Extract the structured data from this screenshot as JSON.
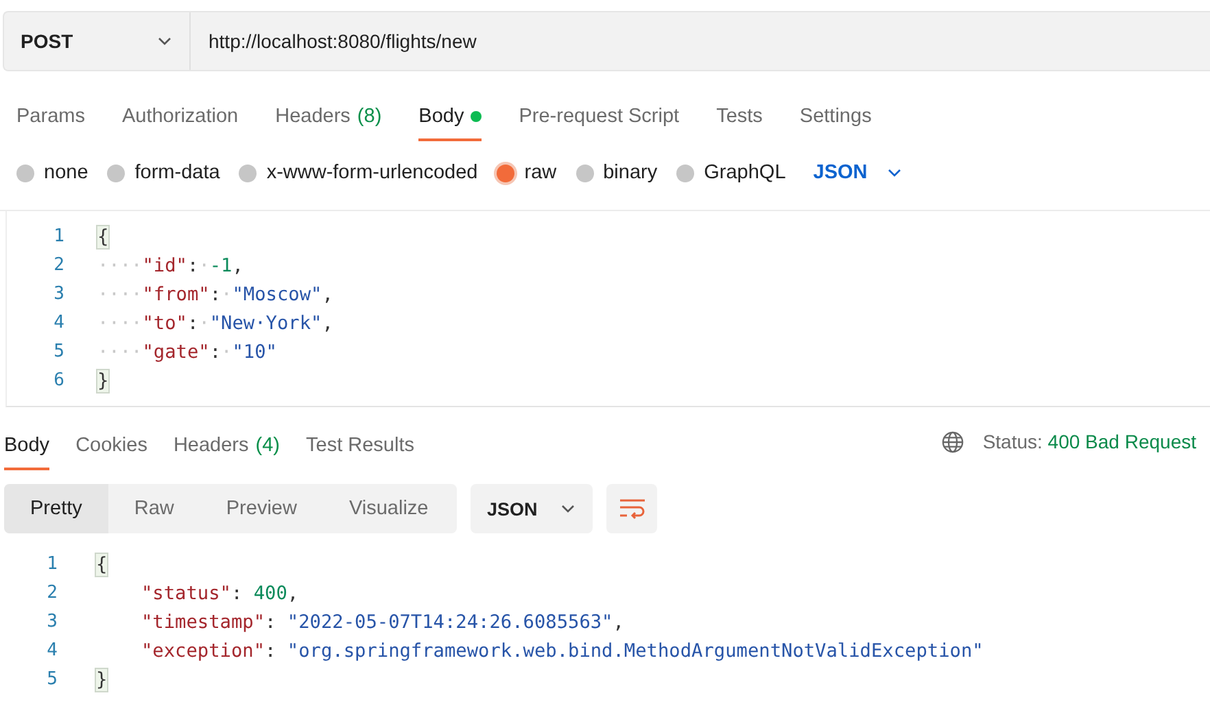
{
  "request": {
    "method": "POST",
    "url": "http://localhost:8080/flights/new"
  },
  "tabs": [
    {
      "label": "Params",
      "selected": false
    },
    {
      "label": "Authorization",
      "selected": false
    },
    {
      "label": "Headers",
      "count": "(8)",
      "selected": false
    },
    {
      "label": "Body",
      "dot": true,
      "selected": true
    },
    {
      "label": "Pre-request Script",
      "selected": false
    },
    {
      "label": "Tests",
      "selected": false
    },
    {
      "label": "Settings",
      "selected": false
    }
  ],
  "body_types": [
    {
      "label": "none",
      "selected": false
    },
    {
      "label": "form-data",
      "selected": false
    },
    {
      "label": "x-www-form-urlencoded",
      "selected": false
    },
    {
      "label": "raw",
      "selected": true
    },
    {
      "label": "binary",
      "selected": false
    },
    {
      "label": "GraphQL",
      "selected": false
    }
  ],
  "body_format": "JSON",
  "request_body": [
    {
      "number": "1",
      "tokens": [
        {
          "kind": "brace",
          "text": "{"
        }
      ]
    },
    {
      "number": "2",
      "tokens": [
        {
          "kind": "ws",
          "text": "····"
        },
        {
          "kind": "key",
          "text": "\"id\""
        },
        {
          "kind": "punct",
          "text": ":"
        },
        {
          "kind": "ws",
          "text": "·"
        },
        {
          "kind": "number",
          "text": "-1"
        },
        {
          "kind": "punct",
          "text": ","
        }
      ]
    },
    {
      "number": "3",
      "tokens": [
        {
          "kind": "ws",
          "text": "····"
        },
        {
          "kind": "key",
          "text": "\"from\""
        },
        {
          "kind": "punct",
          "text": ":"
        },
        {
          "kind": "ws",
          "text": "·"
        },
        {
          "kind": "string",
          "text": "\"Moscow\""
        },
        {
          "kind": "punct",
          "text": ","
        }
      ]
    },
    {
      "number": "4",
      "tokens": [
        {
          "kind": "ws",
          "text": "····"
        },
        {
          "kind": "key",
          "text": "\"to\""
        },
        {
          "kind": "punct",
          "text": ":"
        },
        {
          "kind": "ws",
          "text": "·"
        },
        {
          "kind": "string",
          "text": "\"New·York\""
        },
        {
          "kind": "punct",
          "text": ","
        }
      ]
    },
    {
      "number": "5",
      "tokens": [
        {
          "kind": "ws",
          "text": "····"
        },
        {
          "kind": "key",
          "text": "\"gate\""
        },
        {
          "kind": "punct",
          "text": ":"
        },
        {
          "kind": "ws",
          "text": "·"
        },
        {
          "kind": "string",
          "text": "\"10\""
        }
      ]
    },
    {
      "number": "6",
      "tokens": [
        {
          "kind": "brace",
          "text": "}"
        }
      ]
    }
  ],
  "response_tabs": [
    {
      "label": "Body",
      "selected": true
    },
    {
      "label": "Cookies",
      "selected": false
    },
    {
      "label": "Headers",
      "count": "(4)",
      "selected": false
    },
    {
      "label": "Test Results",
      "selected": false
    }
  ],
  "status": {
    "label": "Status:",
    "value": "400 Bad Request"
  },
  "view_modes": [
    {
      "label": "Pretty",
      "selected": true
    },
    {
      "label": "Raw",
      "selected": false
    },
    {
      "label": "Preview",
      "selected": false
    },
    {
      "label": "Visualize",
      "selected": false
    }
  ],
  "response_format": "JSON",
  "response_body": [
    {
      "number": "1",
      "indented": false,
      "tokens": [
        {
          "kind": "brace",
          "text": "{"
        }
      ]
    },
    {
      "number": "2",
      "indented": true,
      "tokens": [
        {
          "kind": "key",
          "text": "\"status\""
        },
        {
          "kind": "punct",
          "text": ": "
        },
        {
          "kind": "number",
          "text": "400"
        },
        {
          "kind": "punct",
          "text": ","
        }
      ]
    },
    {
      "number": "3",
      "indented": true,
      "tokens": [
        {
          "kind": "key",
          "text": "\"timestamp\""
        },
        {
          "kind": "punct",
          "text": ": "
        },
        {
          "kind": "string",
          "text": "\"2022-05-07T14:24:26.6085563\""
        },
        {
          "kind": "punct",
          "text": ","
        }
      ]
    },
    {
      "number": "4",
      "indented": true,
      "tokens": [
        {
          "kind": "key",
          "text": "\"exception\""
        },
        {
          "kind": "punct",
          "text": ": "
        },
        {
          "kind": "string",
          "text": "\"org.springframework.web.bind.MethodArgumentNotValidException\""
        }
      ]
    },
    {
      "number": "5",
      "indented": false,
      "tokens": [
        {
          "kind": "brace",
          "text": "}"
        }
      ]
    }
  ]
}
